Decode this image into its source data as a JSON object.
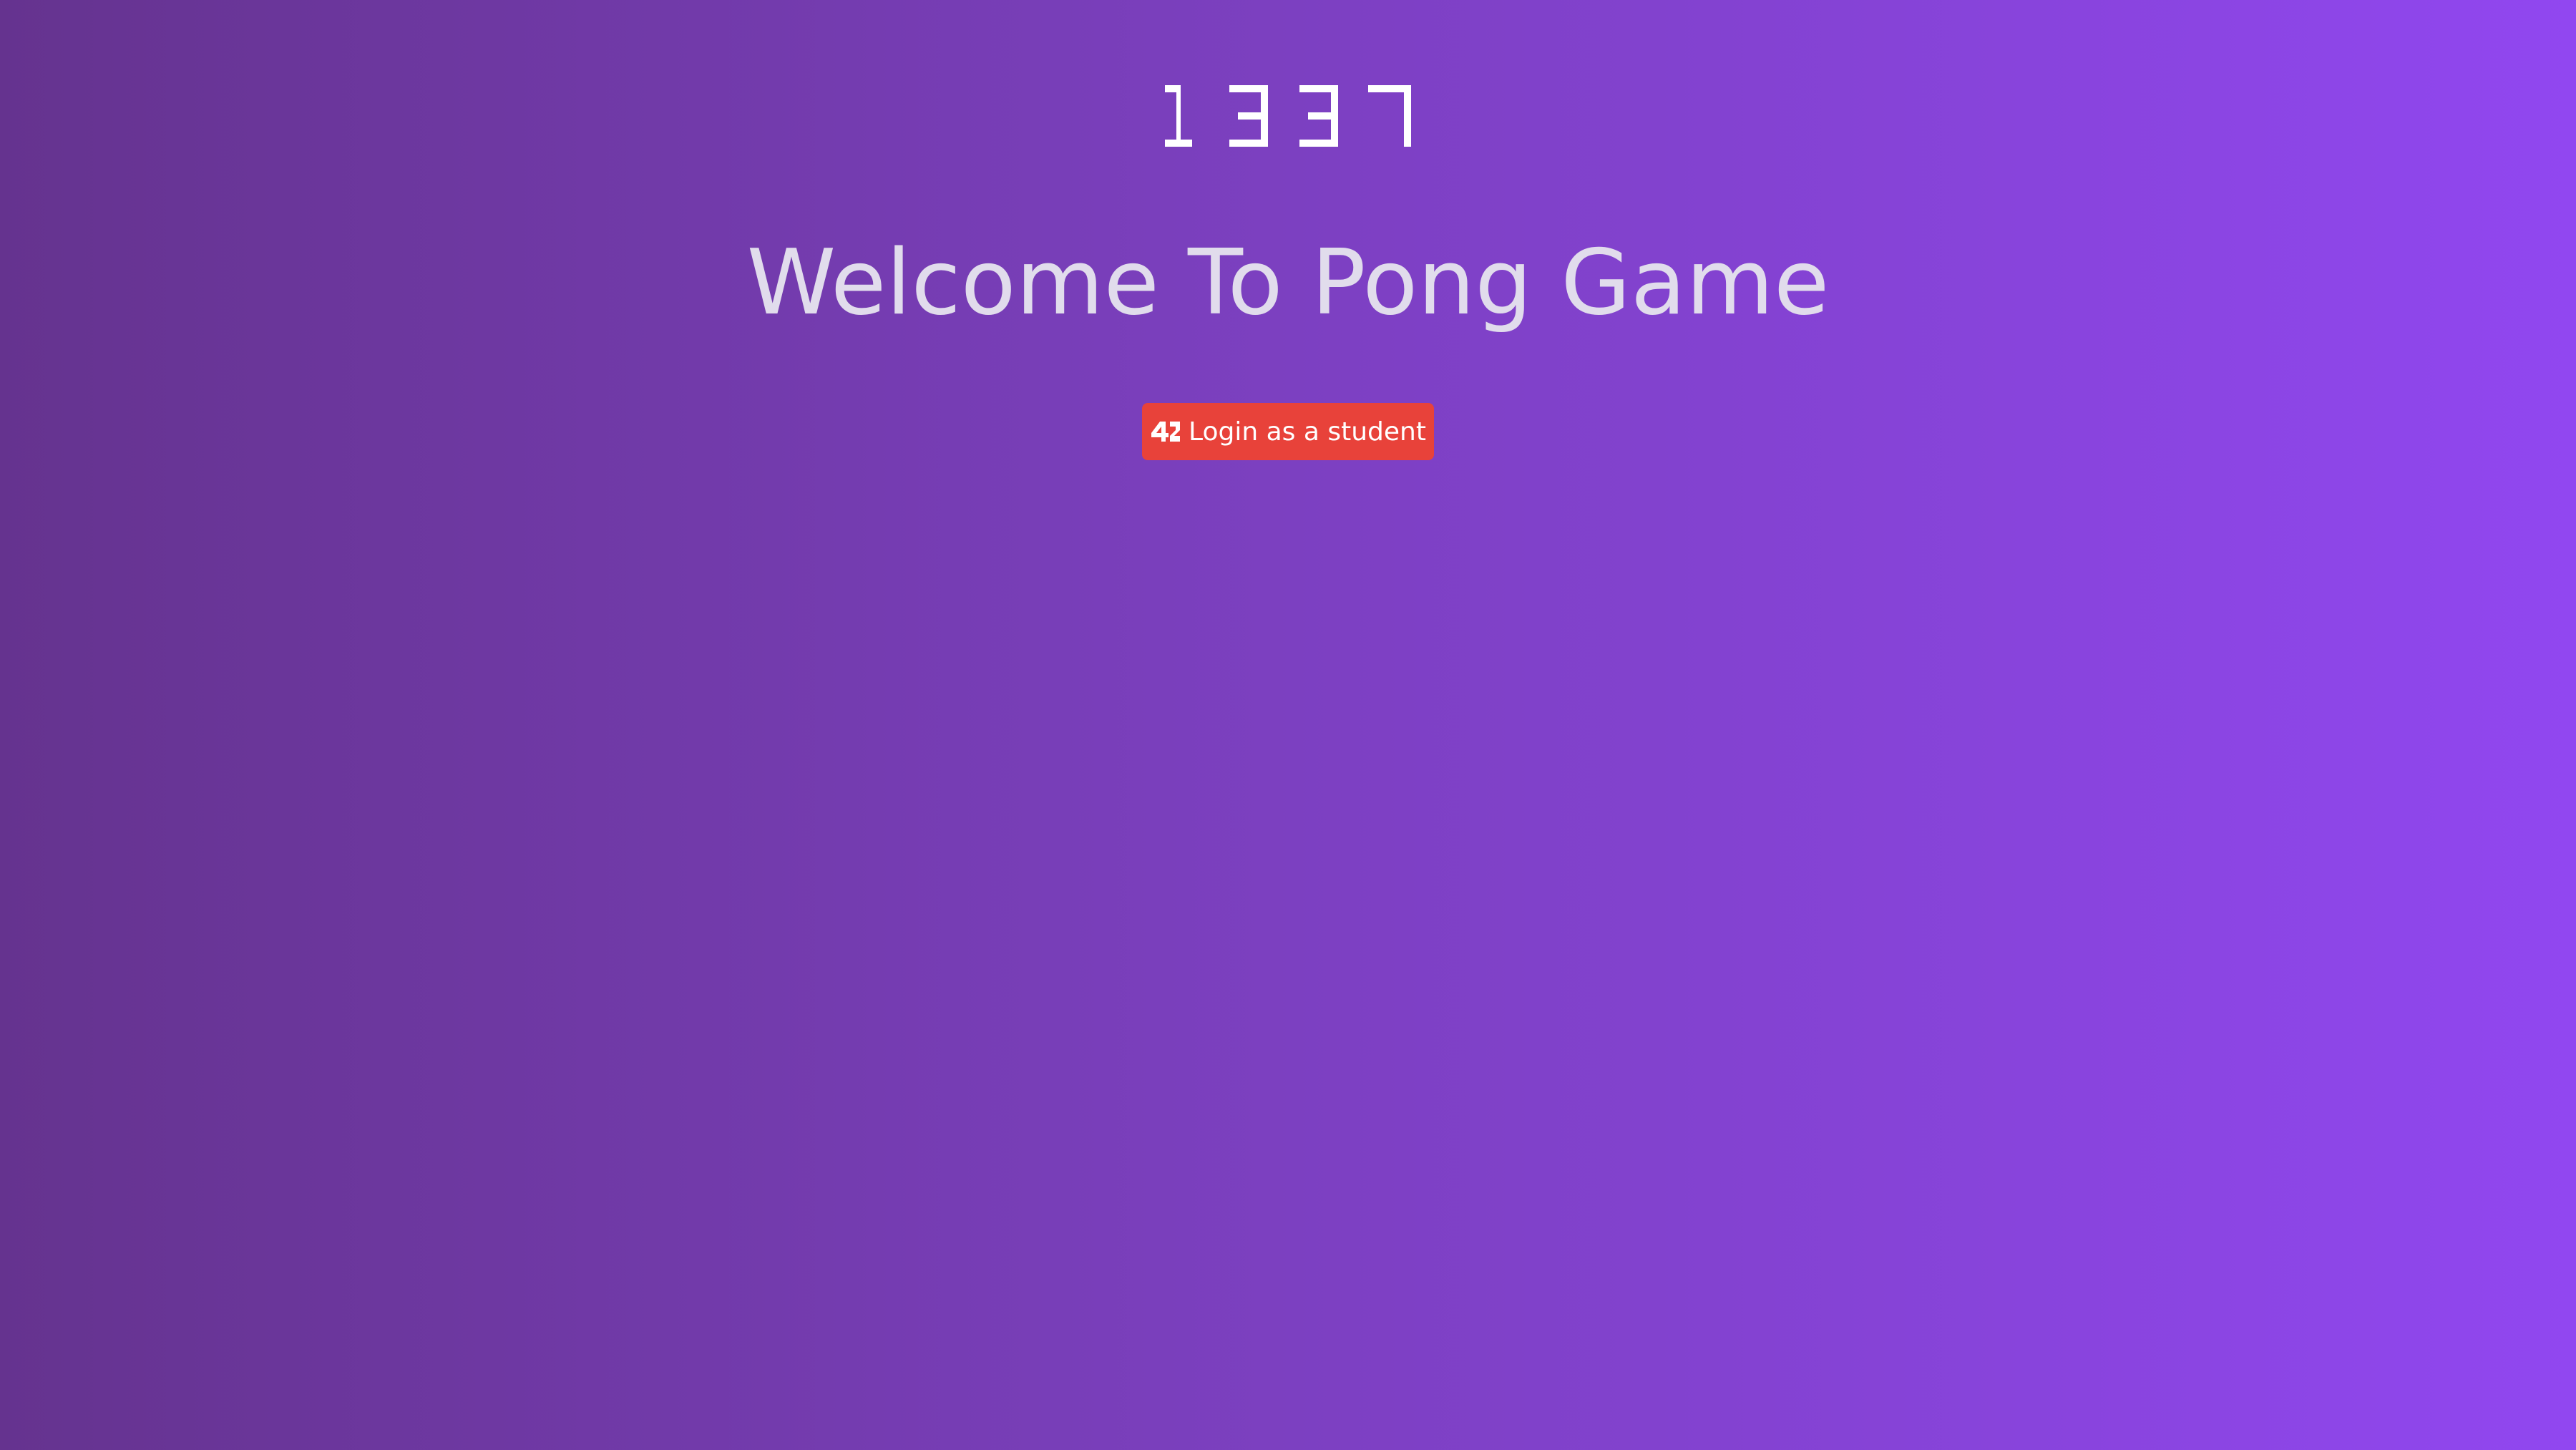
{
  "logo": {
    "text": "1337",
    "icon": "1337-logo"
  },
  "hero": {
    "title": "Welcome To Pong Game"
  },
  "login": {
    "label": "Login as a student",
    "icon": "42-icon",
    "color": "#e8423a"
  },
  "colors": {
    "background_start": "#65338f",
    "background_end": "#9147f0",
    "title_text": "#e1dcec"
  }
}
